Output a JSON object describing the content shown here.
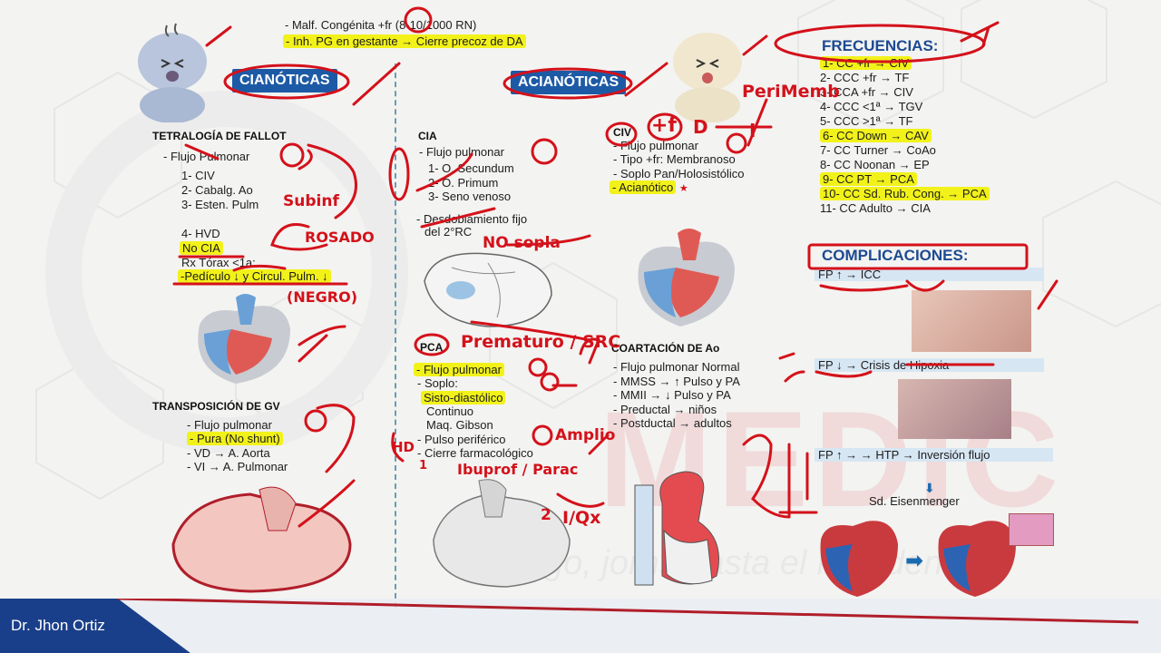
{
  "top": {
    "line1": "- Malf. Congénita +fr (8-10/1000 RN)",
    "line2": "- Inh. PG en gestante → Cierre precoz de DA"
  },
  "cian": {
    "tag": "CIANÓTICAS",
    "tf_title": "TETRALOGÍA DE FALLOT",
    "tf_flujo": "- Flujo Pulmonar",
    "tf_1": "1- CIV",
    "tf_2": "2- Cabalg. Ao",
    "tf_3": "3- Esten. Pulm",
    "tf_4": "4- HVD",
    "tf_nocia": "No CIA",
    "tf_rx": "Rx Tórax <1a:",
    "tf_ped": "-Pedículo ↓ y Circul. Pulm. ↓",
    "tgv_title": "TRANSPOSICIÓN DE GV",
    "tgv_flujo": "- Flujo pulmonar",
    "tgv_pura": "- Pura (No shunt)",
    "tgv_vd": "- VD → A. Aorta",
    "tgv_vi": "- VI → A. Pulmonar"
  },
  "cia": {
    "title": "CIA",
    "flujo": "- Flujo pulmonar",
    "o1": "1- O. Secundum",
    "o2": "2- O. Primum",
    "o3": "3- Seno venoso",
    "desd1": "- Desdoblamiento fijo",
    "desd2": "del 2°RC"
  },
  "pca": {
    "title": "PCA",
    "flujo": "- Flujo pulmonar",
    "soplo": "- Soplo:",
    "sisto": "Sisto-diastólico",
    "continuo": "Continuo",
    "gibson": "Maq. Gibson",
    "pulso": "- Pulso periférico",
    "cierre": "- Cierre farmacológico"
  },
  "acian": {
    "tag": "ACIANÓTICAS",
    "civ_title": "CIV",
    "civ_flujo": "- Flujo pulmonar",
    "civ_tipo": "- Tipo +fr: Membranoso",
    "civ_soplo": "- Soplo Pan/Holosistólico",
    "civ_acian": "- Acianótico"
  },
  "coart": {
    "title": "COARTACIÓN DE Ao",
    "flujo": "- Flujo pulmonar",
    "flujo_val": "Normal",
    "mmss": "- MMSS → ↑ Pulso y PA",
    "mmii": "- MMII → ↓ Pulso y PA",
    "preductal": "- Preductal → niños",
    "postductal": "- Postductal → adultos"
  },
  "freq": {
    "title": "FRECUENCIAS:",
    "items": [
      {
        "text": "1- CC +fr → CIV",
        "hl": true
      },
      {
        "text": "2- CCC +fr → TF",
        "hl": false
      },
      {
        "text": "3- CCA +fr → CIV",
        "hl": false
      },
      {
        "text": "4- CCC <1ª → TGV",
        "hl": false
      },
      {
        "text": "5- CCC >1ª → TF",
        "hl": false
      },
      {
        "text": "6- CC Down → CAV",
        "hl": true
      },
      {
        "text": "7- CC Turner → CoAo",
        "hl": false
      },
      {
        "text": "8- CC Noonan → EP",
        "hl": false
      },
      {
        "text": "9- CC PT → PCA",
        "hl": true
      },
      {
        "text": "10- CC Sd. Rub. Cong. → PCA",
        "hl": true
      },
      {
        "text": "11- CC Adulto → CIA",
        "hl": false
      }
    ]
  },
  "comp": {
    "title": "COMPLICACIONES:",
    "fp1": "FP ↑ → ICC",
    "fp2": "FP ↓ → Crisis de Hipoxia",
    "fp3": "FP ↑ → → HTP → Inversión flujo",
    "eisen": "Sd. Eisenmenger"
  },
  "ink": {
    "subinf": "Subinf",
    "rosado": "ROSADO",
    "negro": "(NEGRO)",
    "nosopla": "NO sopla",
    "prematuro": "Prematuro / SRC",
    "amplio": "Amplio",
    "ibuprof": "Ibuprof / Parac",
    "iqx": "I/Qx",
    "perimemb": "PeriMemb",
    "ho": "HD",
    "two": "2",
    "uno": "1",
    "I": "I",
    "D": "D",
    "pf": "+f"
  },
  "watermark": "MEDIC",
  "watermark2": "go, jorns hasta el Residentado",
  "footer": {
    "name": "Dr. Jhon Ortiz"
  },
  "colors": {
    "accent_blue": "#1d5aa6",
    "highlight": "#f2f21a",
    "ink_red": "#d4111a",
    "footer": "#1a3f8a"
  }
}
